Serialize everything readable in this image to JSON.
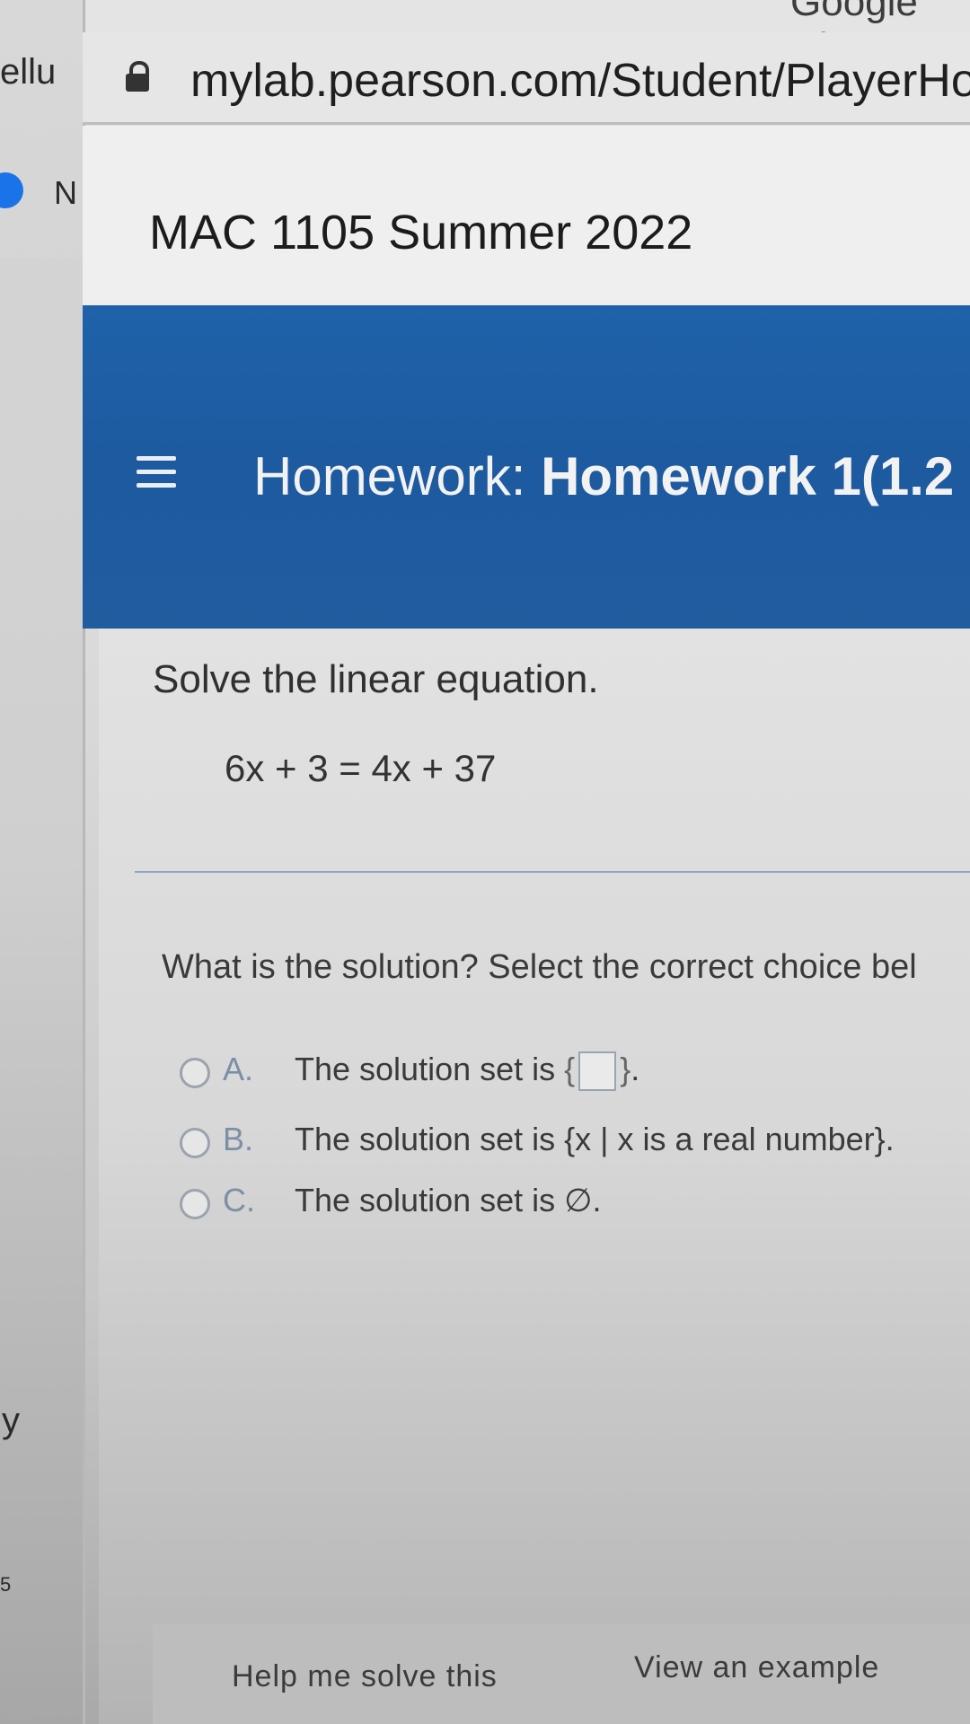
{
  "browser": {
    "window_title_fragment": "Google Ch",
    "url": "mylab.pearson.com/Student/PlayerHor",
    "side_fragments": [
      "ellu",
      "N",
      "y",
      "5"
    ]
  },
  "course": {
    "title": "MAC 1105 Summer 2022"
  },
  "homework": {
    "label": "Homework:",
    "name": "Homework 1(1.2"
  },
  "problem": {
    "instruction": "Solve the linear equation.",
    "equation": "6x + 3 = 4x + 37",
    "question": "What is the solution? Select the correct choice bel",
    "choices": [
      {
        "letter": "A.",
        "text_before": "The solution set is",
        "text_after": "."
      },
      {
        "letter": "B.",
        "text": "The solution set is {x | x is a real number}."
      },
      {
        "letter": "C.",
        "text": "The solution set is ∅."
      }
    ]
  },
  "footer": {
    "help_label": "Help me solve this",
    "example_label": "View an example"
  }
}
